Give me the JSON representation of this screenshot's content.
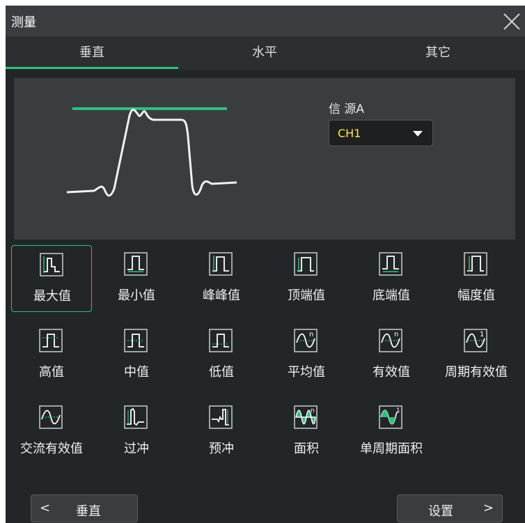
{
  "window": {
    "title": "测量"
  },
  "tabs": [
    {
      "label": "垂直",
      "active": true
    },
    {
      "label": "水平",
      "active": false
    },
    {
      "label": "其它",
      "active": false
    }
  ],
  "source": {
    "label": "信 源A",
    "value": "CH1"
  },
  "measurements": [
    {
      "label": "最大值",
      "icon": "max-icon",
      "selected": true
    },
    {
      "label": "最小值",
      "icon": "min-icon"
    },
    {
      "label": "峰峰值",
      "icon": "peak-peak-icon"
    },
    {
      "label": "顶端值",
      "icon": "top-icon"
    },
    {
      "label": "底端值",
      "icon": "base-icon"
    },
    {
      "label": "幅度值",
      "icon": "amplitude-icon"
    },
    {
      "label": "高值",
      "icon": "upper-icon"
    },
    {
      "label": "中值",
      "icon": "middle-icon"
    },
    {
      "label": "低值",
      "icon": "lower-icon"
    },
    {
      "label": "平均值",
      "icon": "average-icon"
    },
    {
      "label": "有效值",
      "icon": "rms-icon"
    },
    {
      "label": "周期有效值",
      "icon": "period-rms-icon"
    },
    {
      "label": "交流有效值",
      "icon": "ac-rms-icon"
    },
    {
      "label": "过冲",
      "icon": "overshoot-icon"
    },
    {
      "label": "预冲",
      "icon": "preshoot-icon"
    },
    {
      "label": "面积",
      "icon": "area-icon"
    },
    {
      "label": "单周期面积",
      "icon": "period-area-icon"
    }
  ],
  "footer": {
    "prev_label": "垂直",
    "prev_chevron": "<",
    "next_label": "设置",
    "next_chevron": ">"
  },
  "colors": {
    "accent": "#2fbf7f",
    "source_value": "#ffeb3b",
    "background": "#232628",
    "panel": "#3a3d40"
  }
}
